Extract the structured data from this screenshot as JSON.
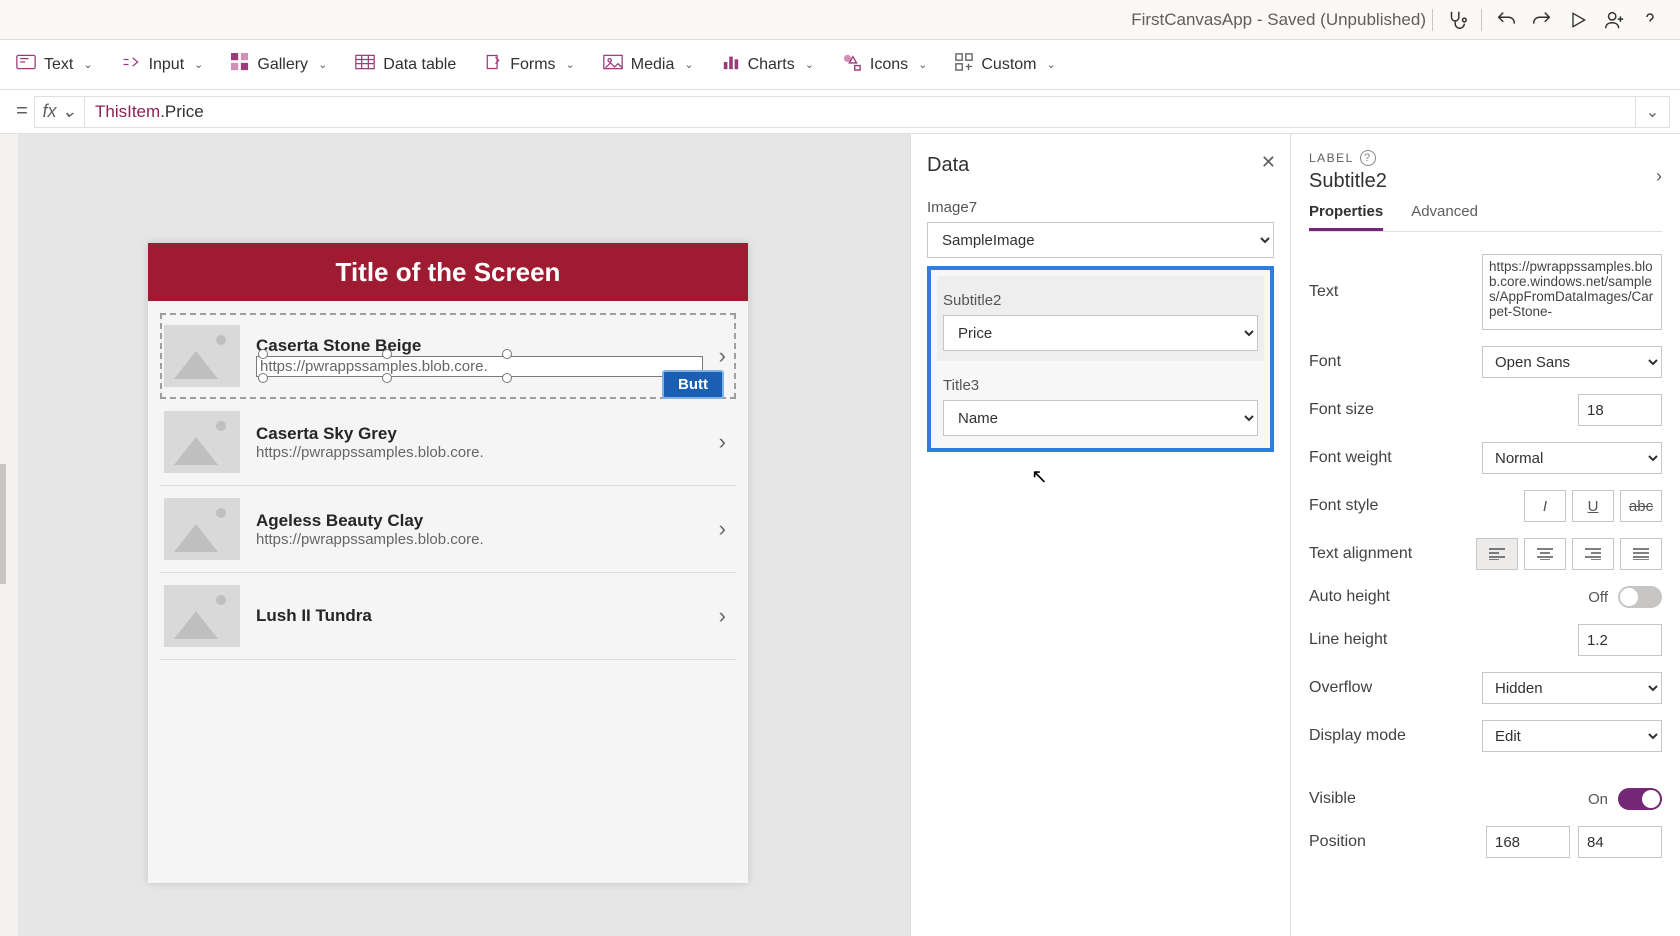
{
  "titlebar": {
    "appname": "FirstCanvasApp - Saved (Unpublished)"
  },
  "ribbon": {
    "text": "Text",
    "input": "Input",
    "gallery": "Gallery",
    "datatable": "Data table",
    "forms": "Forms",
    "media": "Media",
    "charts": "Charts",
    "icons": "Icons",
    "custom": "Custom"
  },
  "formula": {
    "eq": "=",
    "fx": "fx",
    "value": "ThisItem.Price"
  },
  "screen": {
    "title": "Title of the Screen",
    "button": "Butt",
    "items": [
      {
        "title": "Caserta Stone Beige",
        "sub": "https://pwrappssamples.blob.core."
      },
      {
        "title": "Caserta Sky Grey",
        "sub": "https://pwrappssamples.blob.core."
      },
      {
        "title": "Ageless Beauty Clay",
        "sub": "https://pwrappssamples.blob.core."
      },
      {
        "title": "Lush II Tundra",
        "sub": ""
      }
    ]
  },
  "datapanel": {
    "title": "Data",
    "image_label": "Image7",
    "image_value": "SampleImage",
    "subtitle_label": "Subtitle2",
    "subtitle_value": "Price",
    "title_label": "Title3",
    "title_value": "Name"
  },
  "proppanel": {
    "type": "LABEL",
    "name": "Subtitle2",
    "tab_props": "Properties",
    "tab_adv": "Advanced",
    "text_label": "Text",
    "text_value": "https://pwrappssamples.blob.core.windows.net/samples/AppFromDataImages/Carpet-Stone-",
    "font_label": "Font",
    "font_value": "Open Sans",
    "fontsize_label": "Font size",
    "fontsize_value": "18",
    "fontweight_label": "Font weight",
    "fontweight_value": "Normal",
    "fontstyle_label": "Font style",
    "align_label": "Text alignment",
    "autoheight_label": "Auto height",
    "autoheight_state": "Off",
    "lineheight_label": "Line height",
    "lineheight_value": "1.2",
    "overflow_label": "Overflow",
    "overflow_value": "Hidden",
    "display_label": "Display mode",
    "display_value": "Edit",
    "visible_label": "Visible",
    "visible_state": "On",
    "position_label": "Position",
    "pos_x": "168",
    "pos_y": "84"
  }
}
